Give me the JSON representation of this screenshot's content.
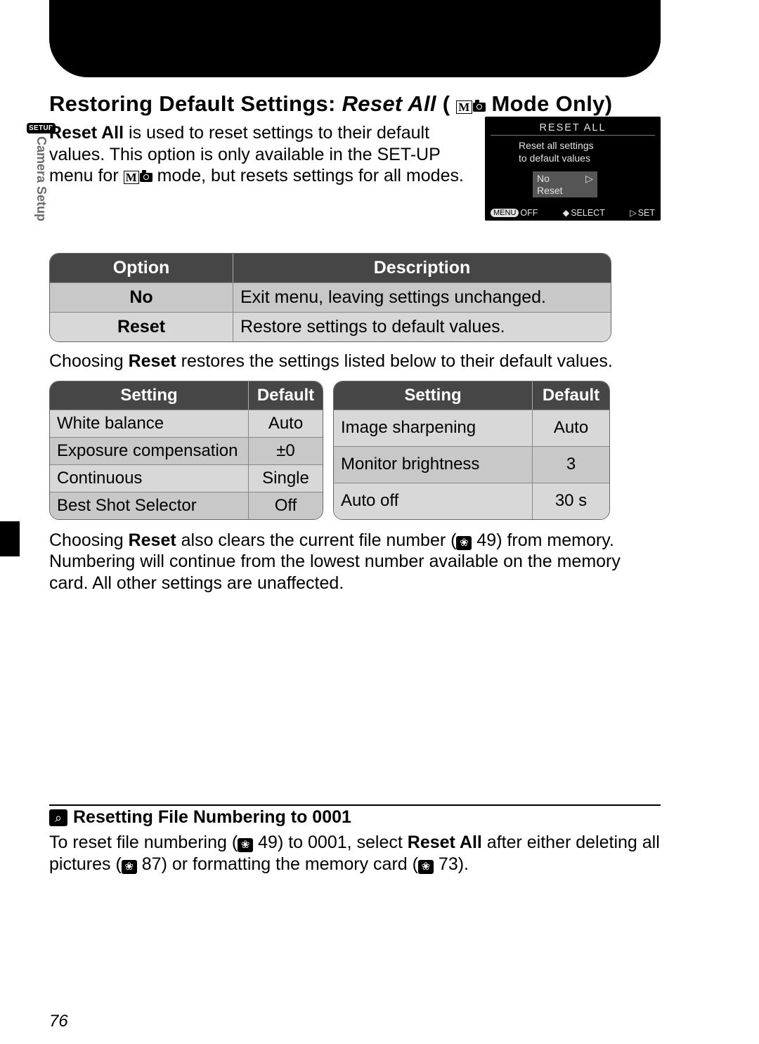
{
  "page_number": "76",
  "side": {
    "badge": "SETUP",
    "label": "Camera Setup"
  },
  "title": {
    "pre": "Restoring Default Settings: ",
    "italic": "Reset All",
    "post": " ( ",
    "mode_m": "M",
    "post2": " Mode Only)"
  },
  "intro": {
    "s1": "Reset All",
    "s2": " is used to reset settings to their default values.  This option is only available in the SET-UP menu for ",
    "m": "M",
    "s3": " mode, but resets settings for all modes."
  },
  "lcd": {
    "title": "RESET ALL",
    "desc1": "Reset all settings",
    "desc2": "to default values",
    "opt_no": "No",
    "opt_reset": "Reset",
    "foot_menu": "MENU",
    "foot_off": "OFF",
    "foot_sel": "SELECT",
    "foot_set": "SET"
  },
  "table1": {
    "h0": "Option",
    "h1": "Description",
    "rows": [
      {
        "opt": "No",
        "desc": "Exit menu, leaving settings unchanged."
      },
      {
        "opt": "Reset",
        "desc": "Restore settings to default values."
      }
    ]
  },
  "para_after_t1": {
    "a": "Choosing ",
    "b": "Reset",
    "c": " restores the settings listed below to their default values."
  },
  "table2": {
    "h0": "Setting",
    "h1": "Default",
    "left": [
      {
        "s": "White balance",
        "d": "Auto"
      },
      {
        "s": "Exposure compensation",
        "d": "±0"
      },
      {
        "s": "Continuous",
        "d": "Single"
      },
      {
        "s": "Best Shot Selector",
        "d": "Off"
      }
    ],
    "right": [
      {
        "s": "Image sharpening",
        "d": "Auto"
      },
      {
        "s": "Monitor brightness",
        "d": "3"
      },
      {
        "s": "Auto off",
        "d": "30 s"
      }
    ]
  },
  "para_after_t2": {
    "a": "Choosing ",
    "b": "Reset",
    "c": " also clears the current file number (",
    "ref1": "49",
    "d": ") from memory. Numbering will continue from the lowest number available on the memory card.  All other settings are unaffected."
  },
  "callout": {
    "title": "Resetting File Numbering to 0001",
    "a": "To reset file numbering (",
    "ref1": "49",
    "b": ") to 0001, select ",
    "c": "Reset All",
    "d": " after either deleting all pictures (",
    "ref2": "87",
    "e": ") or formatting the memory card (",
    "ref3": "73",
    "f": ")."
  }
}
